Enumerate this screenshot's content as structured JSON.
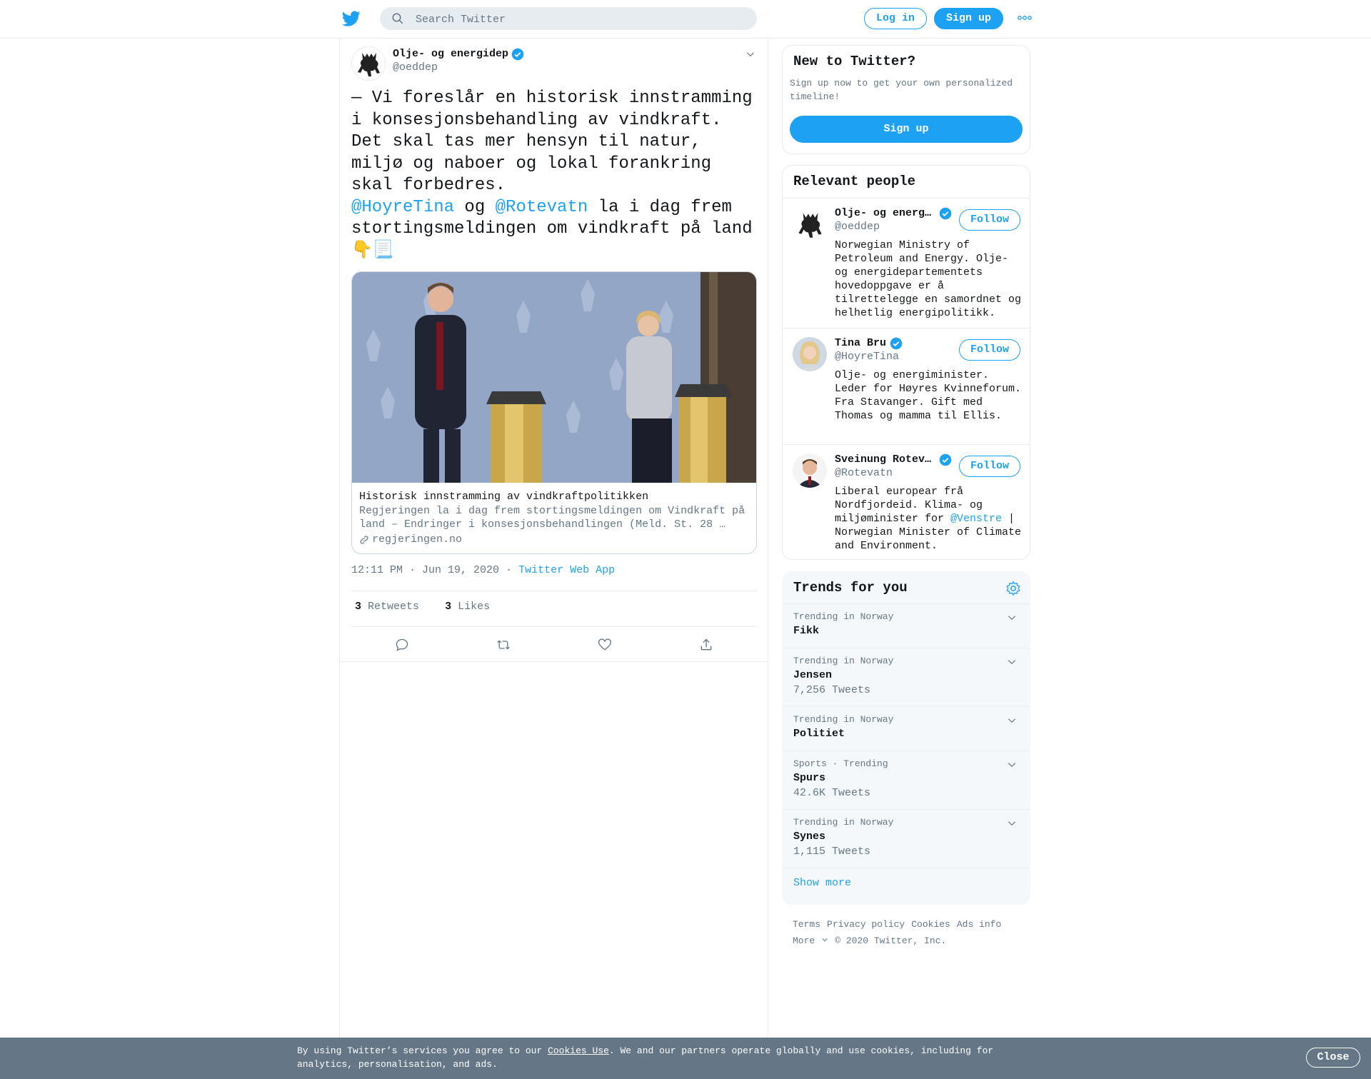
{
  "header": {
    "search_placeholder": "Search Twitter",
    "login_label": "Log in",
    "signup_label": "Sign up"
  },
  "tweet": {
    "author_name": "Olje- og energidep",
    "author_handle": "@oeddep",
    "text_line1": "— Vi foreslår en historisk innstramming i konsesjonsbehandling av vindkraft. Det skal tas mer hensyn til natur, miljø og naboer og lokal forankring skal forbedres.",
    "mention1": "@HoyreTina",
    "text_og": " og ",
    "mention2": "@Rotevatn",
    "text_line2": " la i dag frem stortingsmeldingen om vindkraft på land",
    "emoji": "👇📃",
    "card": {
      "title": "Historisk innstramming av vindkraftpolitikken",
      "description": "Regjeringen la i dag frem stortingsmeldingen om Vindkraft på land – Endringer i konsesjonsbehandlingen (Meld. St. 28 …",
      "domain": "regjeringen.no"
    },
    "time": "12:11 PM · Jun 19, 2020",
    "source": "Twitter Web App",
    "retweets_count": "3",
    "retweets_label": "Retweets",
    "likes_count": "3",
    "likes_label": "Likes"
  },
  "sidebar": {
    "new_to_twitter": {
      "title": "New to Twitter?",
      "subtitle": "Sign up now to get your own personalized timeline!",
      "button": "Sign up"
    },
    "relevant_people": {
      "title": "Relevant people",
      "follow_label": "Follow",
      "people": [
        {
          "name": "Olje- og energ…",
          "handle": "@oeddep",
          "bio": "Norwegian Ministry of Petroleum and Energy. Olje- og energidepartementets hovedoppgave er å tilrettelegge en samordnet og helhetlig energipolitikk."
        },
        {
          "name": "Tina Bru",
          "handle": "@HoyreTina",
          "bio": "Olje- og energiminister. Leder for Høyres Kvinneforum. Fra Stavanger. Gift med Thomas og mamma til Ellis."
        },
        {
          "name": "Sveinung Rotev…",
          "handle": "@Rotevatn",
          "bio_before": "Liberal europear frå Nordfjordeid. Klima- og miljøminister for ",
          "bio_mention": "@Venstre",
          "bio_after": " | Norwegian Minister of Climate and Environment."
        }
      ]
    },
    "trends": {
      "title": "Trends for you",
      "items": [
        {
          "context": "Trending in Norway",
          "name": "Fikk",
          "count": ""
        },
        {
          "context": "Trending in Norway",
          "name": "Jensen",
          "count": "7,256 Tweets"
        },
        {
          "context": "Trending in Norway",
          "name": "Politiet",
          "count": ""
        },
        {
          "context": "Sports · Trending",
          "name": "Spurs",
          "count": "42.6K Tweets"
        },
        {
          "context": "Trending in Norway",
          "name": "Synes",
          "count": "1,115 Tweets"
        }
      ],
      "show_more": "Show more"
    },
    "footer": {
      "terms": "Terms",
      "privacy": "Privacy policy",
      "cookies": "Cookies",
      "ads": "Ads info",
      "more": "More",
      "copyright": "© 2020 Twitter, Inc."
    }
  },
  "cookie_bar": {
    "text_before": "By using Twitter’s services you agree to our ",
    "link": "Cookies Use",
    "text_after": ". We and our partners operate globally and use cookies, including for analytics, personalisation, and ads.",
    "close": "Close"
  },
  "colors": {
    "accent": "#1da1f2",
    "secondary_text": "#657786",
    "border": "#e6ecf0",
    "cookie_bar": "#657786"
  }
}
